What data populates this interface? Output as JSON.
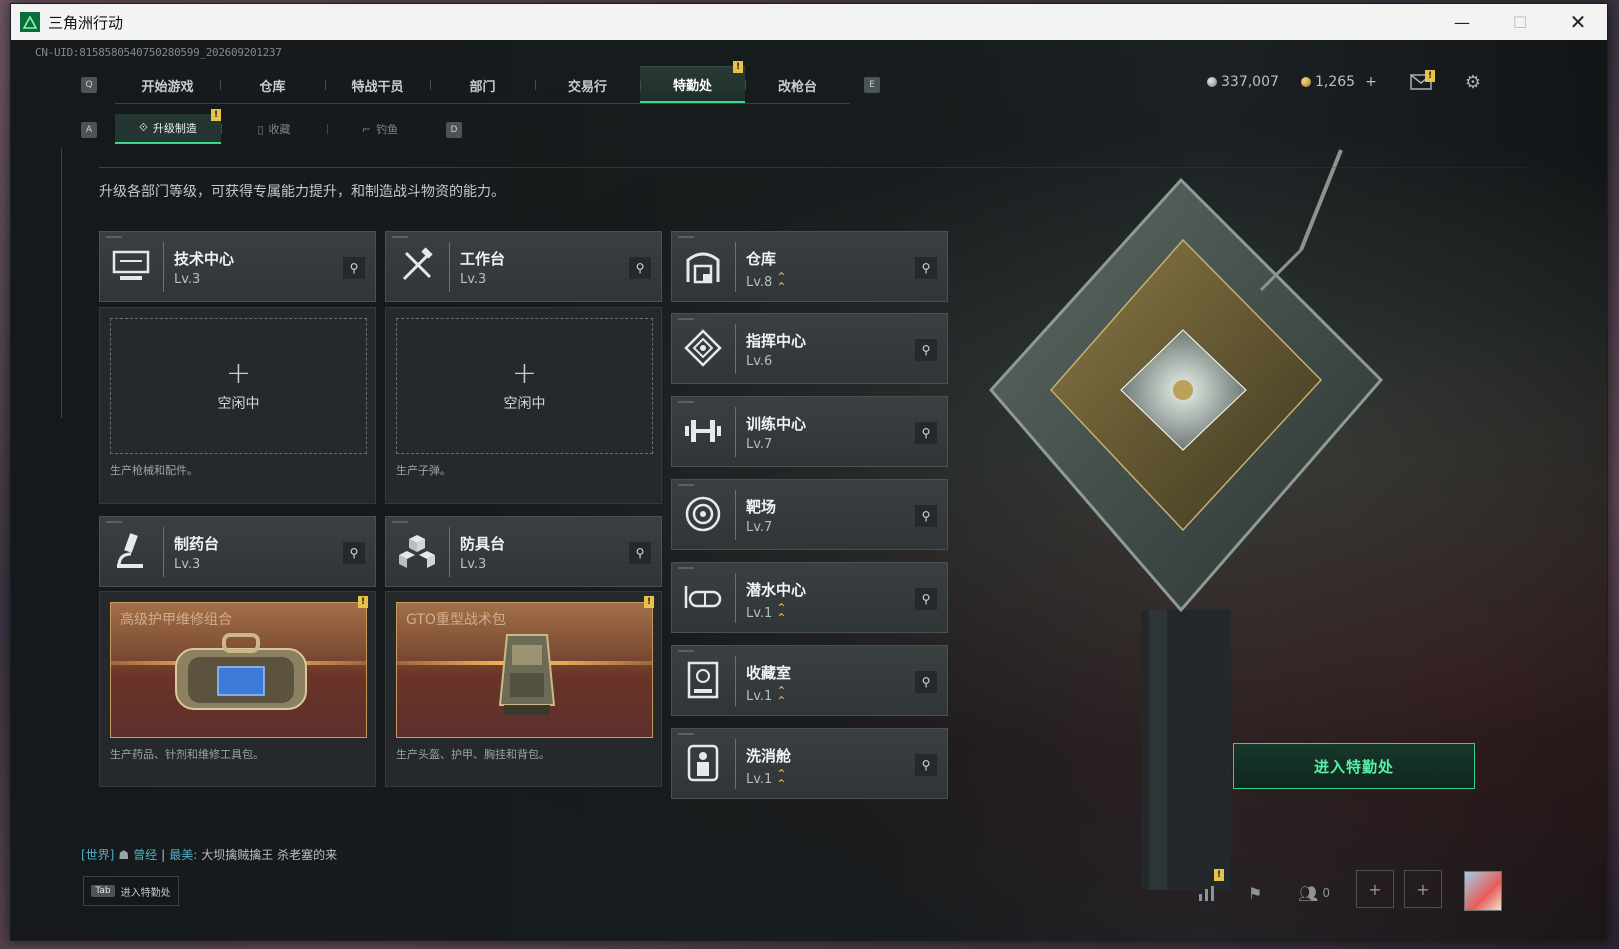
{
  "window": {
    "title": "三角洲行动",
    "minimize": "—",
    "maximize": "☐",
    "close": "✕"
  },
  "uid": "CN-UID:8158580540750280599_202609201237",
  "main_nav": {
    "left_key": "Q",
    "right_key": "E",
    "tabs": [
      "开始游戏",
      "仓库",
      "特战干员",
      "部门",
      "交易行",
      "特勤处",
      "改枪台"
    ],
    "active": "特勤处",
    "badge": "!"
  },
  "sub_nav": {
    "left_key": "A",
    "right_key": "D",
    "tabs": [
      "升级制造",
      "收藏",
      "钓鱼"
    ],
    "active": "升级制造",
    "badge": "!"
  },
  "currency": {
    "silver": "337,007",
    "gold": "1,265",
    "add": "+"
  },
  "description": "升级各部门等级，可获得专属能力提升，和制造战斗物资的能力。",
  "production": [
    {
      "name": "技术中心",
      "level": "Lv.3",
      "icon": "monitor-icon",
      "slot": {
        "state": "idle",
        "plus": "+",
        "label": "空闲中"
      },
      "note": "生产枪械和配件。"
    },
    {
      "name": "工作台",
      "level": "Lv.3",
      "icon": "tools-icon",
      "slot": {
        "state": "idle",
        "plus": "+",
        "label": "空闲中"
      },
      "note": "生产子弹。"
    },
    {
      "name": "制药台",
      "level": "Lv.3",
      "icon": "microscope-icon",
      "slot": {
        "state": "item",
        "label": "高级护甲维修组合",
        "badge": "!"
      },
      "note": "生产药品、针剂和维修工具包。"
    },
    {
      "name": "防具台",
      "level": "Lv.3",
      "icon": "cubes-icon",
      "slot": {
        "state": "item",
        "label": "GTO重型战术包",
        "badge": "!"
      },
      "note": "生产头盔、护甲、胸挂和背包。"
    }
  ],
  "facilities": [
    {
      "name": "仓库",
      "level": "Lv.8",
      "upgrade": true,
      "icon": "warehouse-icon"
    },
    {
      "name": "指挥中心",
      "level": "Lv.6",
      "upgrade": false,
      "icon": "command-icon"
    },
    {
      "name": "训练中心",
      "level": "Lv.7",
      "upgrade": false,
      "icon": "dumbbell-icon"
    },
    {
      "name": "靶场",
      "level": "Lv.7",
      "upgrade": false,
      "icon": "target-icon"
    },
    {
      "name": "潜水中心",
      "level": "Lv.1",
      "upgrade": true,
      "icon": "goggles-icon"
    },
    {
      "name": "收藏室",
      "level": "Lv.1",
      "upgrade": true,
      "icon": "collection-icon"
    },
    {
      "name": "洗消舱",
      "level": "Lv.1",
      "upgrade": true,
      "icon": "decon-icon"
    }
  ],
  "enter_button": "进入特勤处",
  "chat": {
    "channel": "[世界]",
    "sender": "曾经",
    "separator": "|",
    "sender2": "最美:",
    "message": "大坝擒贼擒王 杀老塞的来"
  },
  "tab_hint": {
    "key": "Tab",
    "label": "进入特勤处"
  },
  "bottom_bar": {
    "friends_count": "0",
    "badge": "!"
  }
}
